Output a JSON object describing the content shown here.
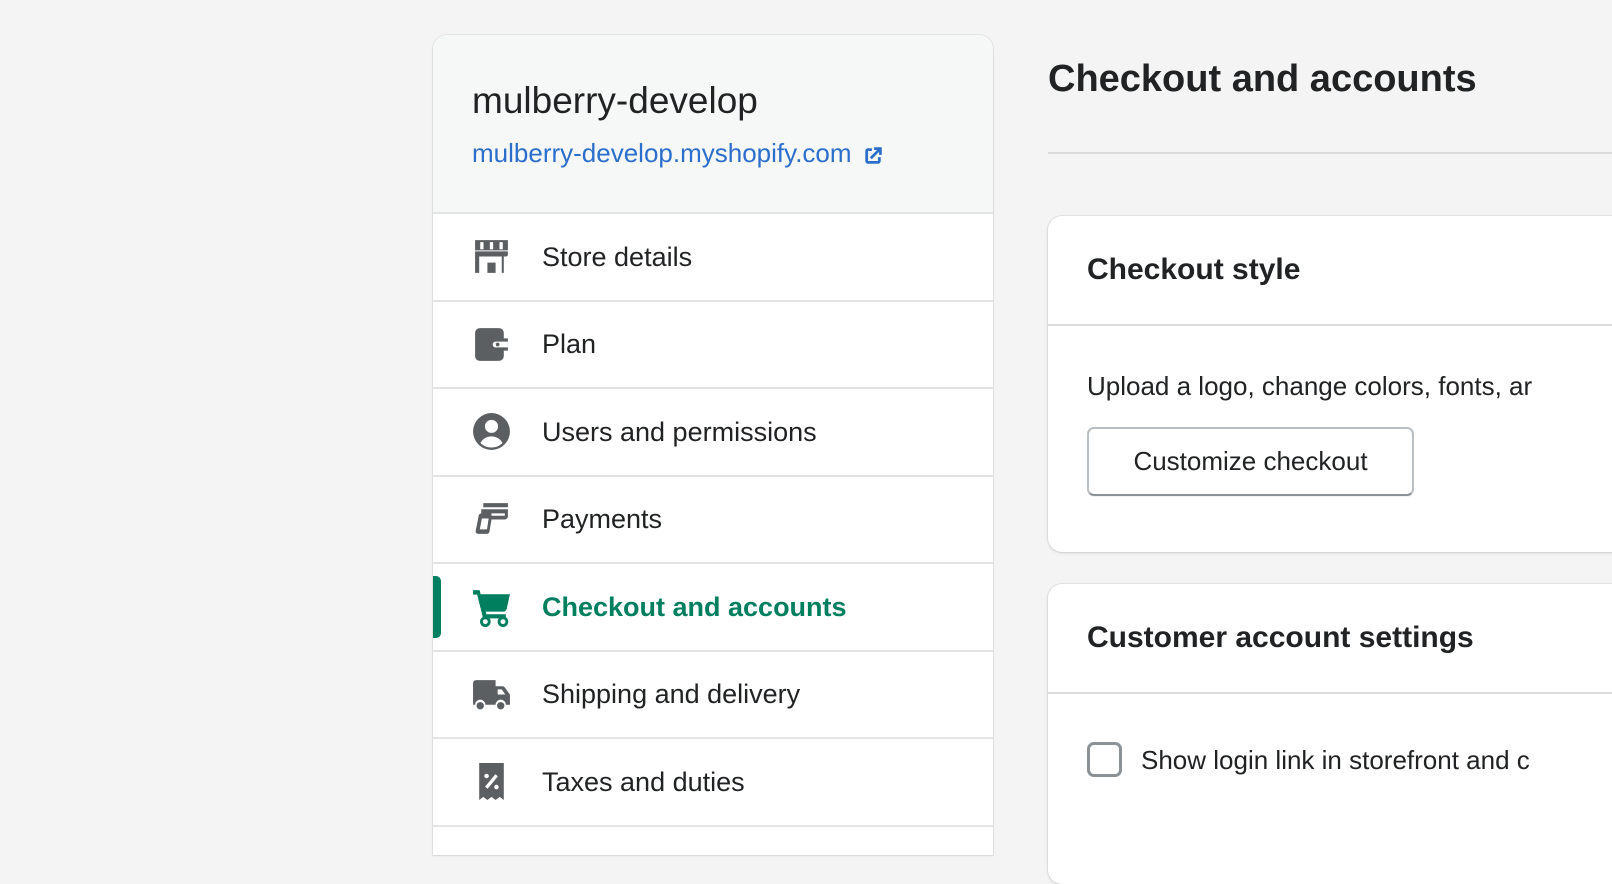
{
  "store": {
    "name": "mulberry-develop",
    "url": "mulberry-develop.myshopify.com",
    "url_icon": "external-link-icon"
  },
  "nav": {
    "items": [
      {
        "label": "Store details",
        "icon": "store-icon",
        "active": false
      },
      {
        "label": "Plan",
        "icon": "wallet-icon",
        "active": false
      },
      {
        "label": "Users and permissions",
        "icon": "user-circle-icon",
        "active": false
      },
      {
        "label": "Payments",
        "icon": "payment-icon",
        "active": false
      },
      {
        "label": "Checkout and accounts",
        "icon": "cart-icon",
        "active": true
      },
      {
        "label": "Shipping and delivery",
        "icon": "truck-icon",
        "active": false
      },
      {
        "label": "Taxes and duties",
        "icon": "receipt-percent-icon",
        "active": false
      }
    ]
  },
  "page": {
    "title": "Checkout and accounts"
  },
  "checkout_style": {
    "title": "Checkout style",
    "description": "Upload a logo, change colors, fonts, ar",
    "button_label": "Customize checkout"
  },
  "customer_accounts": {
    "title": "Customer account settings",
    "checkbox_label": "Show login link in storefront and c",
    "checkbox_checked": false
  },
  "colors": {
    "accent": "#008060",
    "link": "#2c6ecb",
    "icon": "#5c5f62",
    "background": "#f4f4f4"
  }
}
